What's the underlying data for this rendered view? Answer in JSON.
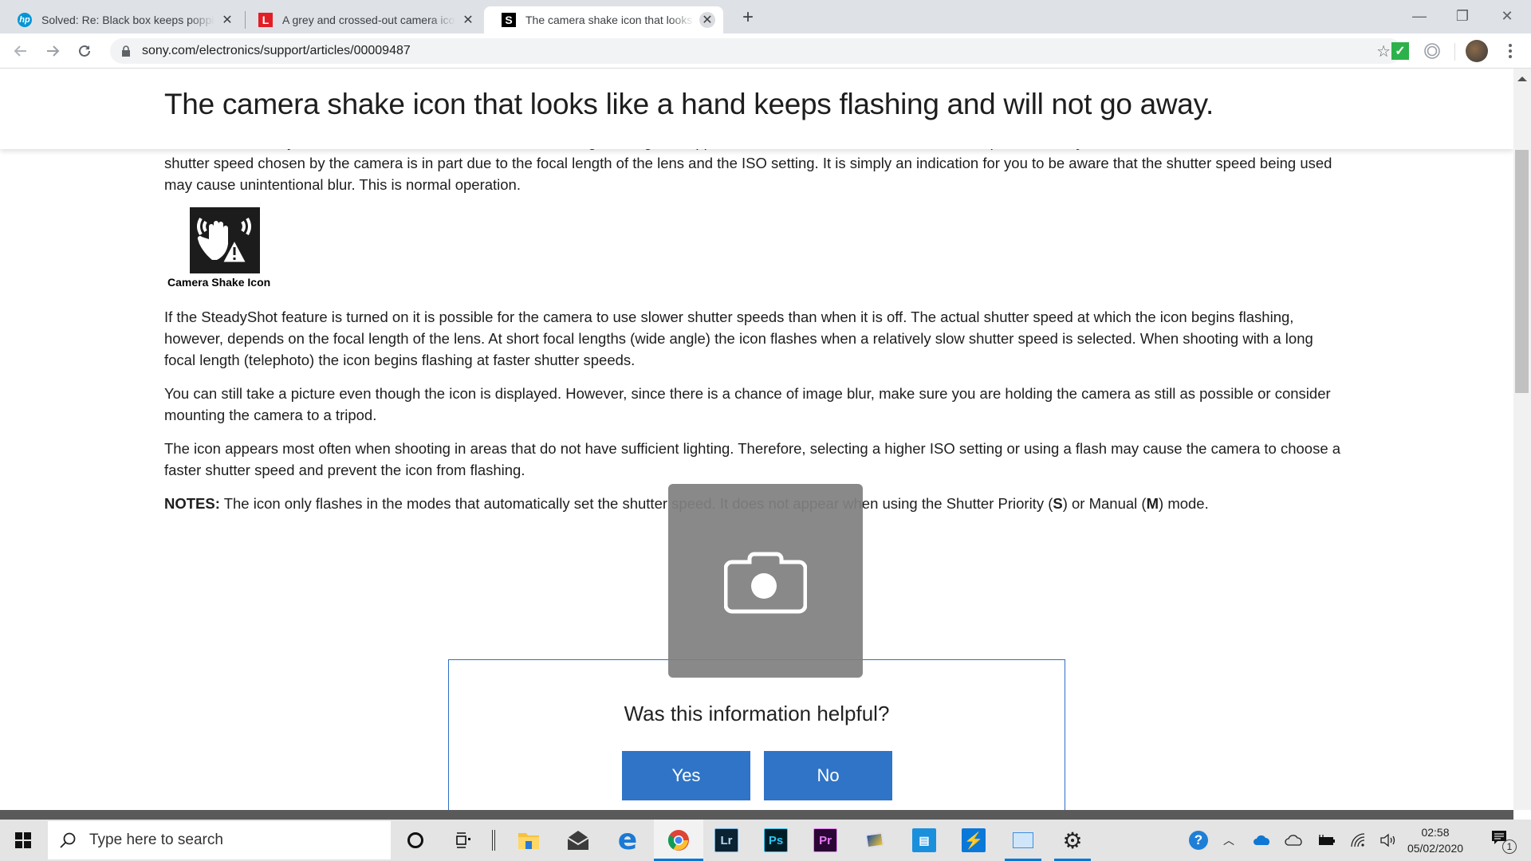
{
  "browser": {
    "tabs": [
      {
        "favicon": "hp",
        "title": "Solved: Re: Black box keeps popping up",
        "active": false,
        "favicon_color": "#0096d6"
      },
      {
        "favicon": "L",
        "title": "A grey and crossed-out camera icon",
        "active": false,
        "favicon_color": "#e21f26"
      },
      {
        "favicon": "S",
        "title": "The camera shake icon that looks like a hand",
        "active": true,
        "favicon_color": "#000000"
      }
    ],
    "new_tab_symbol": "+",
    "close_symbol": "✕",
    "url": "sony.com/electronics/support/articles/00009487",
    "window_controls": {
      "minimize": "—",
      "maximize": "❐",
      "close": "✕"
    }
  },
  "article": {
    "title": "The camera shake icon that looks like a hand keeps flashing and will not go away.",
    "intro_partial": "Whether the SteadyShot™ feature is turned on or not, the flashing warning icon appears when the camera chooses a shutter speed that may be too slow for the intended shot. The shutter speed chosen by the camera is in part due to the focal length of the lens and the ISO setting. It is simply an indication for you to be aware that the shutter speed being used may cause unintentional blur. This is normal operation.",
    "figure_caption": "Camera Shake Icon",
    "paragraphs": [
      "If the SteadyShot feature is turned on it is possible for the camera to use slower shutter speeds than when it is off. The actual shutter speed at which the icon begins flashing, however, depends on the focal length of the lens. At short focal lengths (wide angle) the icon flashes when a relatively slow shutter speed is selected. When shooting with a long focal length (telephoto) the icon begins flashing at faster shutter speeds.",
      "You can still take a picture even though the icon is displayed. However, since there is a chance of image blur, make sure you are holding the camera as still as possible or consider mounting the camera to a tripod.",
      "The icon appears most often when shooting in areas that do not have sufficient lighting. Therefore, selecting a higher ISO setting or using a flash may cause the camera to choose a faster shutter speed and prevent the icon from flashing."
    ],
    "notes": {
      "label": "NOTES:",
      "text_before": " The icon only flashes in the modes that automatically set the shutter speed. It does not appear when using the Shutter Priority (",
      "mode_s": "S",
      "text_mid": ") or Manual (",
      "mode_m": "M",
      "text_after": ") mode."
    }
  },
  "feedback": {
    "question": "Was this information helpful?",
    "yes_label": "Yes",
    "no_label": "No",
    "button_color": "#2f74c6"
  },
  "overlay": {
    "icon": "camera-icon"
  },
  "taskbar": {
    "search_placeholder": "Type here to search",
    "apps": [
      {
        "name": "cortana",
        "glyph": "O"
      },
      {
        "name": "task-view",
        "glyph": "⧉"
      },
      {
        "name": "file-explorer",
        "glyph": ""
      },
      {
        "name": "mail",
        "glyph": "✉"
      },
      {
        "name": "edge",
        "glyph": "e"
      },
      {
        "name": "chrome",
        "glyph": ""
      },
      {
        "name": "lightroom",
        "glyph": "Lr"
      },
      {
        "name": "photoshop",
        "glyph": "Ps"
      },
      {
        "name": "premiere",
        "glyph": "Pr"
      },
      {
        "name": "photo-viewer",
        "glyph": ""
      },
      {
        "name": "print-app",
        "glyph": ""
      },
      {
        "name": "bolt-app",
        "glyph": ""
      },
      {
        "name": "control-panel",
        "glyph": ""
      },
      {
        "name": "settings",
        "glyph": "⚙"
      }
    ],
    "time": "02:58",
    "date": "05/02/2020",
    "notification_count": "1"
  }
}
